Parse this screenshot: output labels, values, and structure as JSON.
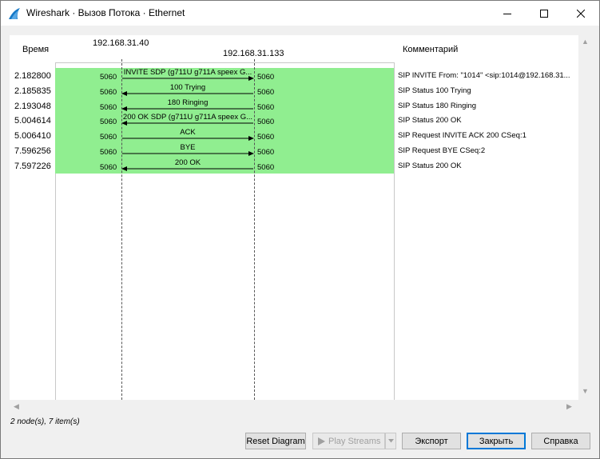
{
  "window": {
    "title": "Wireshark · Вызов Потока · Ethernet"
  },
  "header": {
    "time_label": "Время",
    "comment_label": "Комментарий",
    "node_left": "192.168.31.40",
    "node_right": "192.168.31.133"
  },
  "flows": [
    {
      "time": "2.182800",
      "src_port": "5060",
      "dst_port": "5060",
      "label": "INVITE SDP (g711U g711A speex G...",
      "direction": "right",
      "comment": "SIP INVITE From: \"1014\" <sip:1014@192.168.31..."
    },
    {
      "time": "2.185835",
      "src_port": "5060",
      "dst_port": "5060",
      "label": "100 Trying",
      "direction": "left",
      "comment": "SIP Status 100 Trying"
    },
    {
      "time": "2.193048",
      "src_port": "5060",
      "dst_port": "5060",
      "label": "180 Ringing",
      "direction": "left",
      "comment": "SIP Status 180 Ringing"
    },
    {
      "time": "5.004614",
      "src_port": "5060",
      "dst_port": "5060",
      "label": "200 OK SDP (g711U g711A speex G...",
      "direction": "left",
      "comment": "SIP Status 200 OK"
    },
    {
      "time": "5.006410",
      "src_port": "5060",
      "dst_port": "5060",
      "label": "ACK",
      "direction": "right",
      "comment": "SIP Request INVITE ACK 200 CSeq:1"
    },
    {
      "time": "7.596256",
      "src_port": "5060",
      "dst_port": "5060",
      "label": "BYE",
      "direction": "right",
      "comment": "SIP Request BYE CSeq:2"
    },
    {
      "time": "7.597226",
      "src_port": "5060",
      "dst_port": "5060",
      "label": "200 OK",
      "direction": "left",
      "comment": "SIP Status 200 OK"
    }
  ],
  "status": {
    "text": "2 node(s), 7 item(s)"
  },
  "buttons": {
    "reset": "Reset Diagram",
    "play": "Play Streams",
    "export": "Экспорт",
    "close": "Закрыть",
    "help": "Справка"
  },
  "colors": {
    "flow_highlight": "#90ee90",
    "default_button_border": "#0078d7"
  },
  "icons": {
    "app": "wireshark-fin-icon",
    "play": "play-icon",
    "dropdown": "chevron-down-icon"
  }
}
